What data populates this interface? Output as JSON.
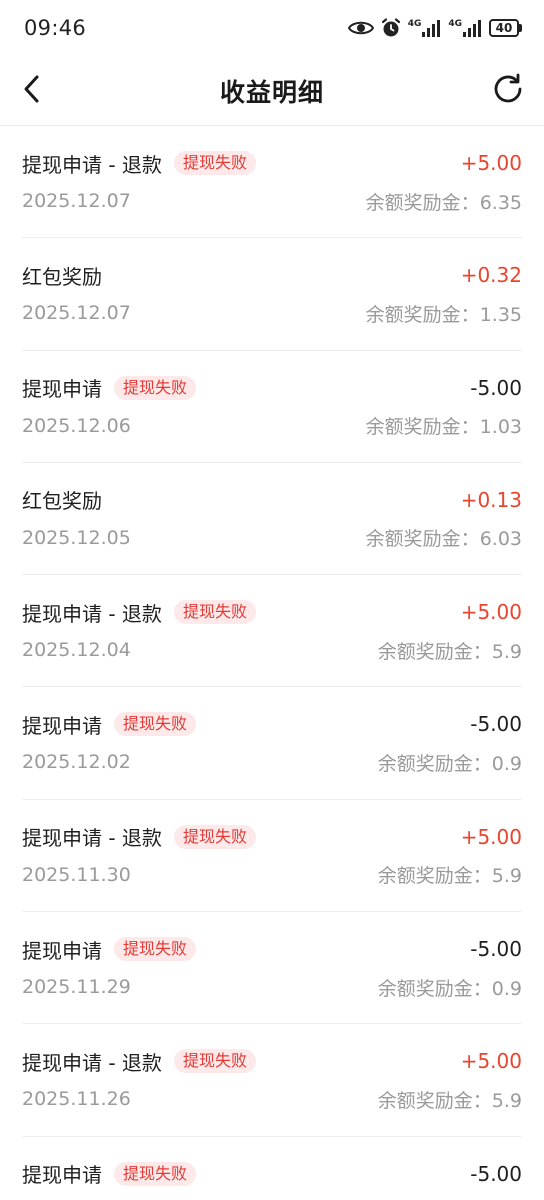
{
  "status_bar": {
    "time": "09:46",
    "signal_1": "4G",
    "signal_2": "4G",
    "battery": "40"
  },
  "header": {
    "title": "收益明细"
  },
  "balance_label": "余额奖励金：",
  "records": [
    {
      "title": "提现申请 - 退款",
      "tag": "提现失败",
      "amount": "+5.00",
      "date": "2025.12.07",
      "balance": "6.35",
      "positive": true
    },
    {
      "title": "红包奖励",
      "tag": "",
      "amount": "+0.32",
      "date": "2025.12.07",
      "balance": "1.35",
      "positive": true
    },
    {
      "title": "提现申请",
      "tag": "提现失败",
      "amount": "-5.00",
      "date": "2025.12.06",
      "balance": "1.03",
      "positive": false
    },
    {
      "title": "红包奖励",
      "tag": "",
      "amount": "+0.13",
      "date": "2025.12.05",
      "balance": "6.03",
      "positive": true
    },
    {
      "title": "提现申请 - 退款",
      "tag": "提现失败",
      "amount": "+5.00",
      "date": "2025.12.04",
      "balance": "5.9",
      "positive": true
    },
    {
      "title": "提现申请",
      "tag": "提现失败",
      "amount": "-5.00",
      "date": "2025.12.02",
      "balance": "0.9",
      "positive": false
    },
    {
      "title": "提现申请 - 退款",
      "tag": "提现失败",
      "amount": "+5.00",
      "date": "2025.11.30",
      "balance": "5.9",
      "positive": true
    },
    {
      "title": "提现申请",
      "tag": "提现失败",
      "amount": "-5.00",
      "date": "2025.11.29",
      "balance": "0.9",
      "positive": false
    },
    {
      "title": "提现申请 - 退款",
      "tag": "提现失败",
      "amount": "+5.00",
      "date": "2025.11.26",
      "balance": "5.9",
      "positive": true
    },
    {
      "title": "提现申请",
      "tag": "提现失败",
      "amount": "-5.00",
      "date": "",
      "balance": "",
      "positive": false
    }
  ],
  "colors": {
    "positive": "#e8452f",
    "negative": "#1f1f1f",
    "tag_bg": "#fde9e9",
    "tag_text": "#e23b36",
    "secondary_text": "#9a9a9a"
  },
  "icons": [
    "back-arrow-icon",
    "refresh-icon",
    "eye-icon",
    "alarm-icon",
    "signal-icon",
    "battery-icon"
  ]
}
